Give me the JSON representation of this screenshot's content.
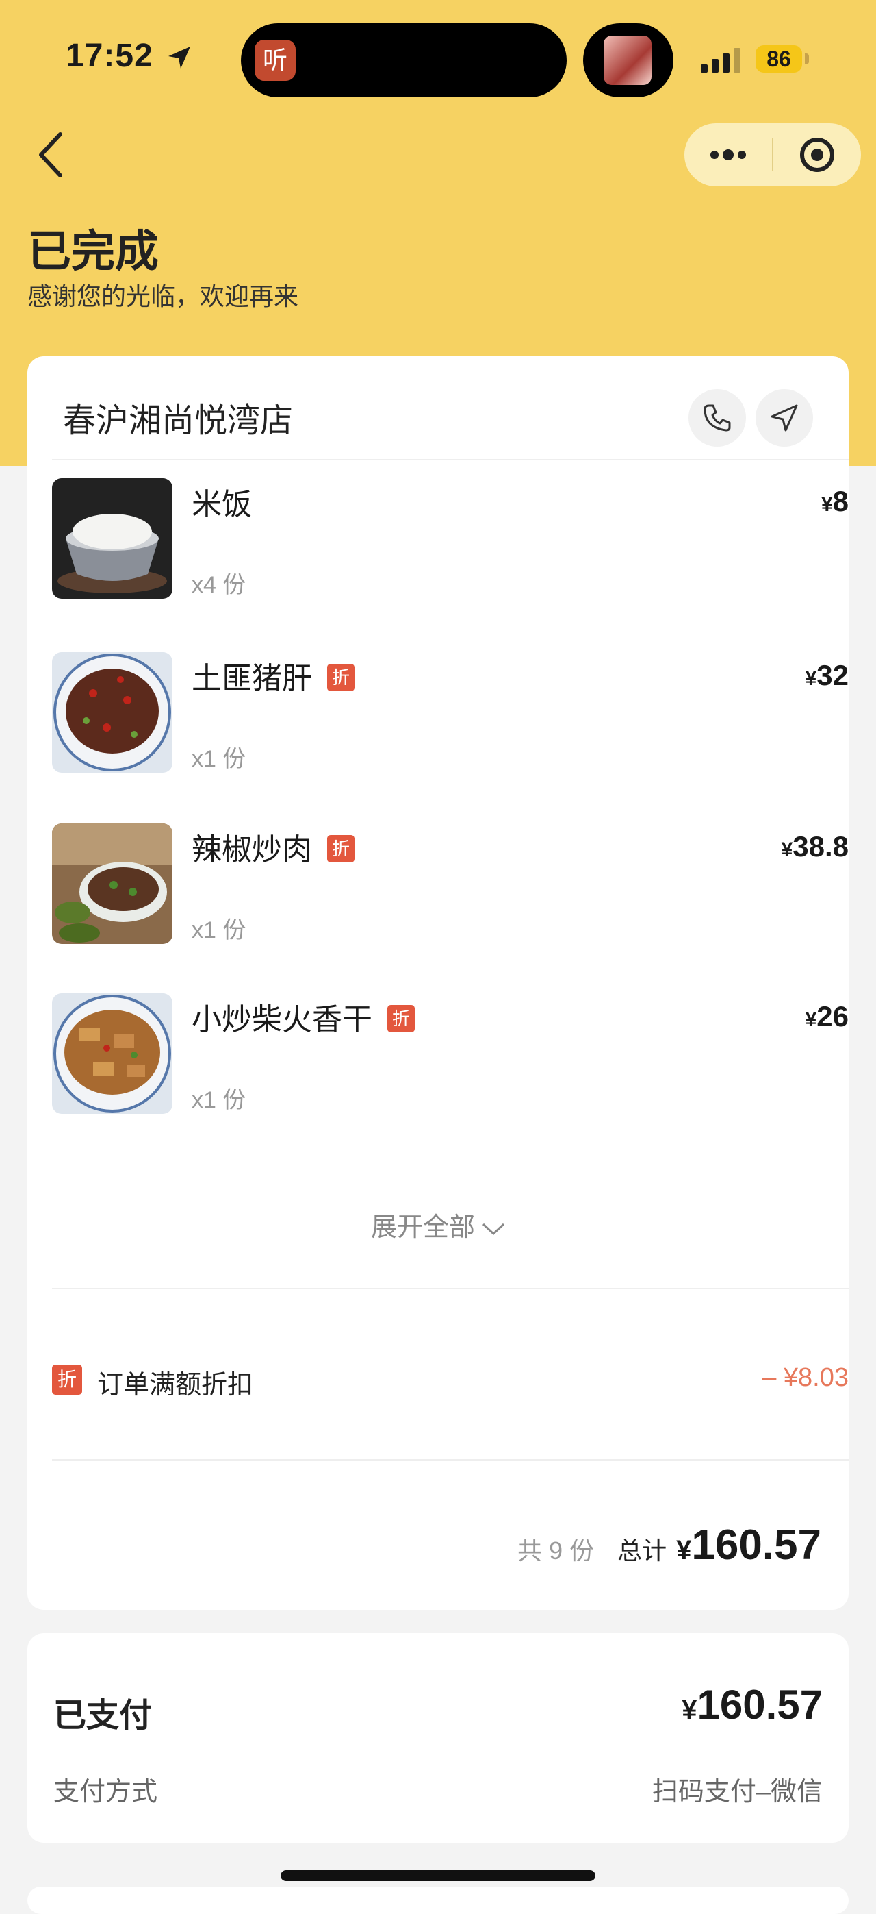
{
  "status_bar": {
    "time": "17:52",
    "battery": "86",
    "island_app_char": "听"
  },
  "header": {
    "status_title": "已完成",
    "status_subtitle": "感谢您的光临，欢迎再来"
  },
  "shop": {
    "name": "春沪湘尚悦湾店"
  },
  "items": [
    {
      "name": "米饭",
      "qty": "x4 份",
      "yen": "¥",
      "price": "8",
      "tag": ""
    },
    {
      "name": "土匪猪肝",
      "qty": "x1 份",
      "yen": "¥",
      "price": "32",
      "tag": "折"
    },
    {
      "name": "辣椒炒肉",
      "qty": "x1 份",
      "yen": "¥",
      "price": "38.8",
      "tag": "折"
    },
    {
      "name": "小炒柴火香干",
      "qty": "x1 份",
      "yen": "¥",
      "price": "26",
      "tag": "折"
    }
  ],
  "expand_label": "展开全部",
  "discount": {
    "tag": "折",
    "label": "订单满额折扣",
    "amount": "– ¥8.03"
  },
  "summary": {
    "count": "共 9 份",
    "total_label": "总计",
    "yen": "¥",
    "total": "160.57"
  },
  "payment": {
    "paid_label": "已支付",
    "yen": "¥",
    "paid_amount": "160.57",
    "method_label": "支付方式",
    "method_value": "扫码支付–微信"
  },
  "colors": {
    "hero": "#f6d262",
    "accent_tag": "#e3573d",
    "discount_text": "#e7785b"
  },
  "icons": [
    "location-arrow-icon",
    "signal-icon",
    "back-arrow-icon",
    "more-dots-icon",
    "close-target-icon",
    "phone-icon",
    "navigate-icon",
    "chevron-down-icon"
  ]
}
